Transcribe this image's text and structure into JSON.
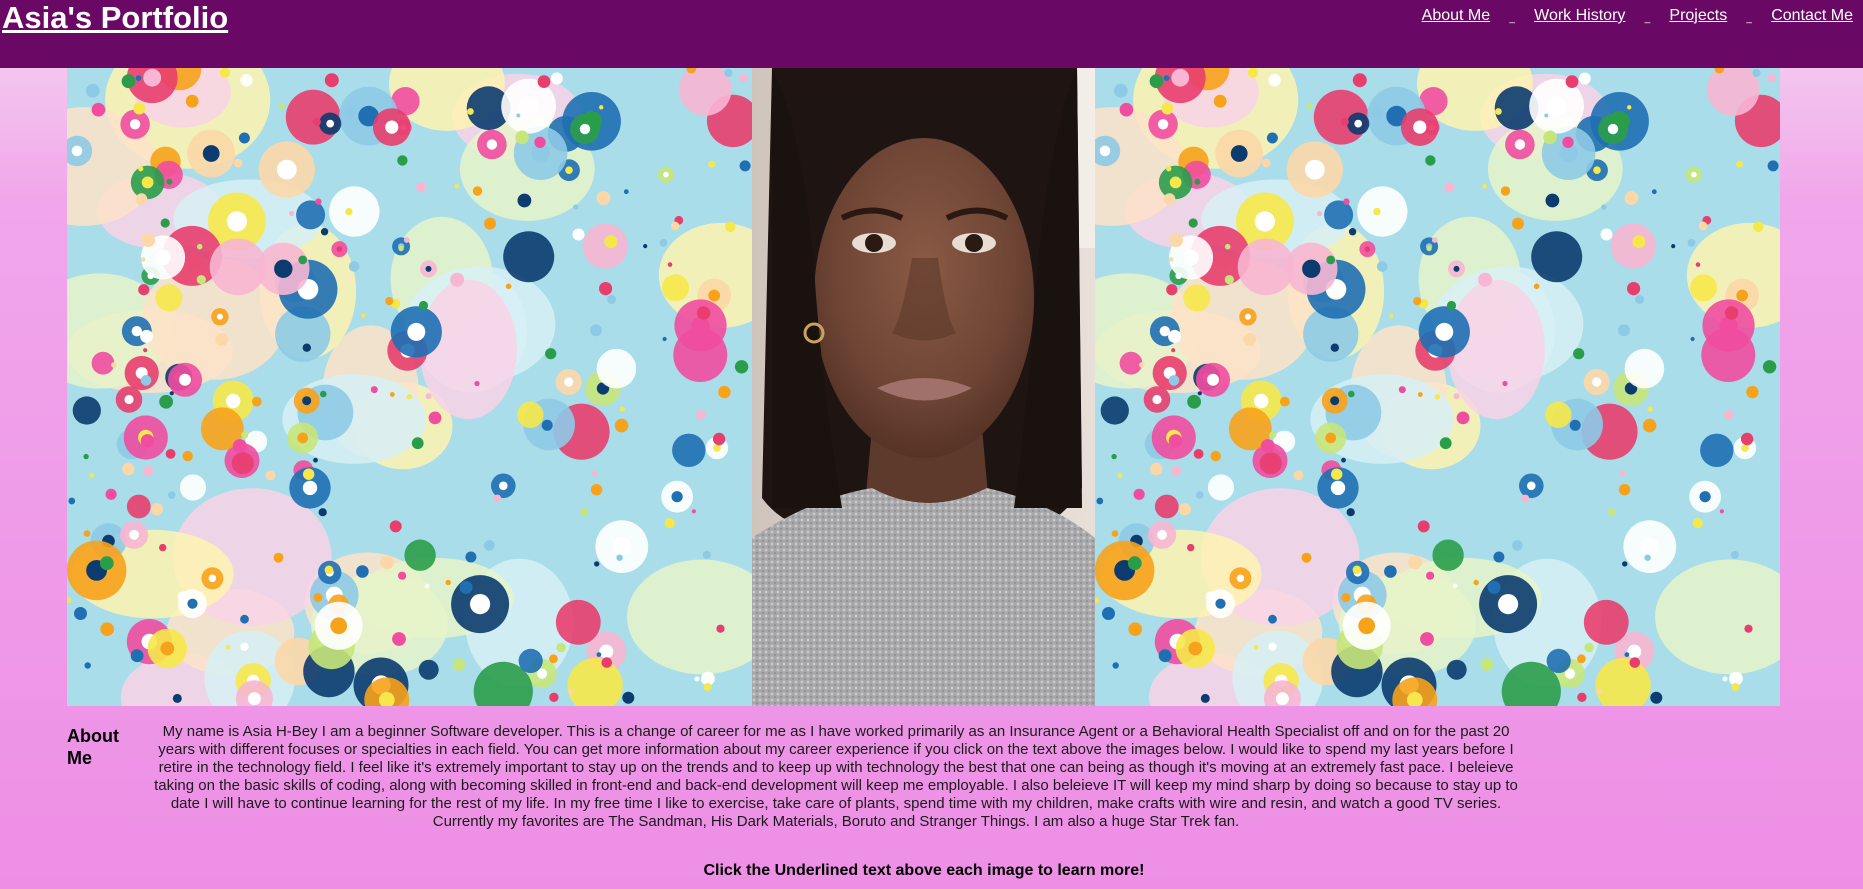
{
  "header": {
    "title": "Asia's Portfolio",
    "nav": [
      {
        "label": "About Me"
      },
      {
        "label": "Work History"
      },
      {
        "label": "Projects"
      },
      {
        "label": "Contact Me"
      }
    ],
    "separator": "_"
  },
  "gallery": {
    "images": [
      {
        "name": "colorful-dot-pattern"
      },
      {
        "name": "portrait-photo"
      },
      {
        "name": "colorful-dot-pattern"
      }
    ]
  },
  "about": {
    "heading": "About Me",
    "body": "My name is Asia H-Bey I am a beginner Software developer. This is a change of career for me as I have worked primarily as an Insurance Agent or a Behavioral Health Specialist off and on for the past 20 years with different focuses or specialties in each field. You can get more information about my career experience if you click on the text above the images below. I would like to spend my last years before I retire in the technology field. I feel like it's extremely important to stay up on the trends and to keep up with technology the best that one can being as though it's moving at an extremely fast pace. I beleieve taking on the basic skills of coding, along with becoming skilled in front-end and back-end development will keep me employable. I also beleieve IT will keep my mind sharp by doing so because to stay up to date I will have to continue learning for the rest of my life. In my free time I like to exercise, take care of plants, spend time with my children, make crafts with wire and resin, and watch a good TV series. Currently my favorites are The Sandman, His Dark Materials, Boruto and Stranger Things. I am also a huge Star Trek fan."
  },
  "footer": {
    "cta": "Click the Underlined text above each image to learn more!"
  },
  "colors": {
    "header_bg": "#6a0866",
    "page_bg_top": "#f6d6f1",
    "page_bg_bottom": "#ee8fe6",
    "pattern_bg": "#a9ddea"
  }
}
